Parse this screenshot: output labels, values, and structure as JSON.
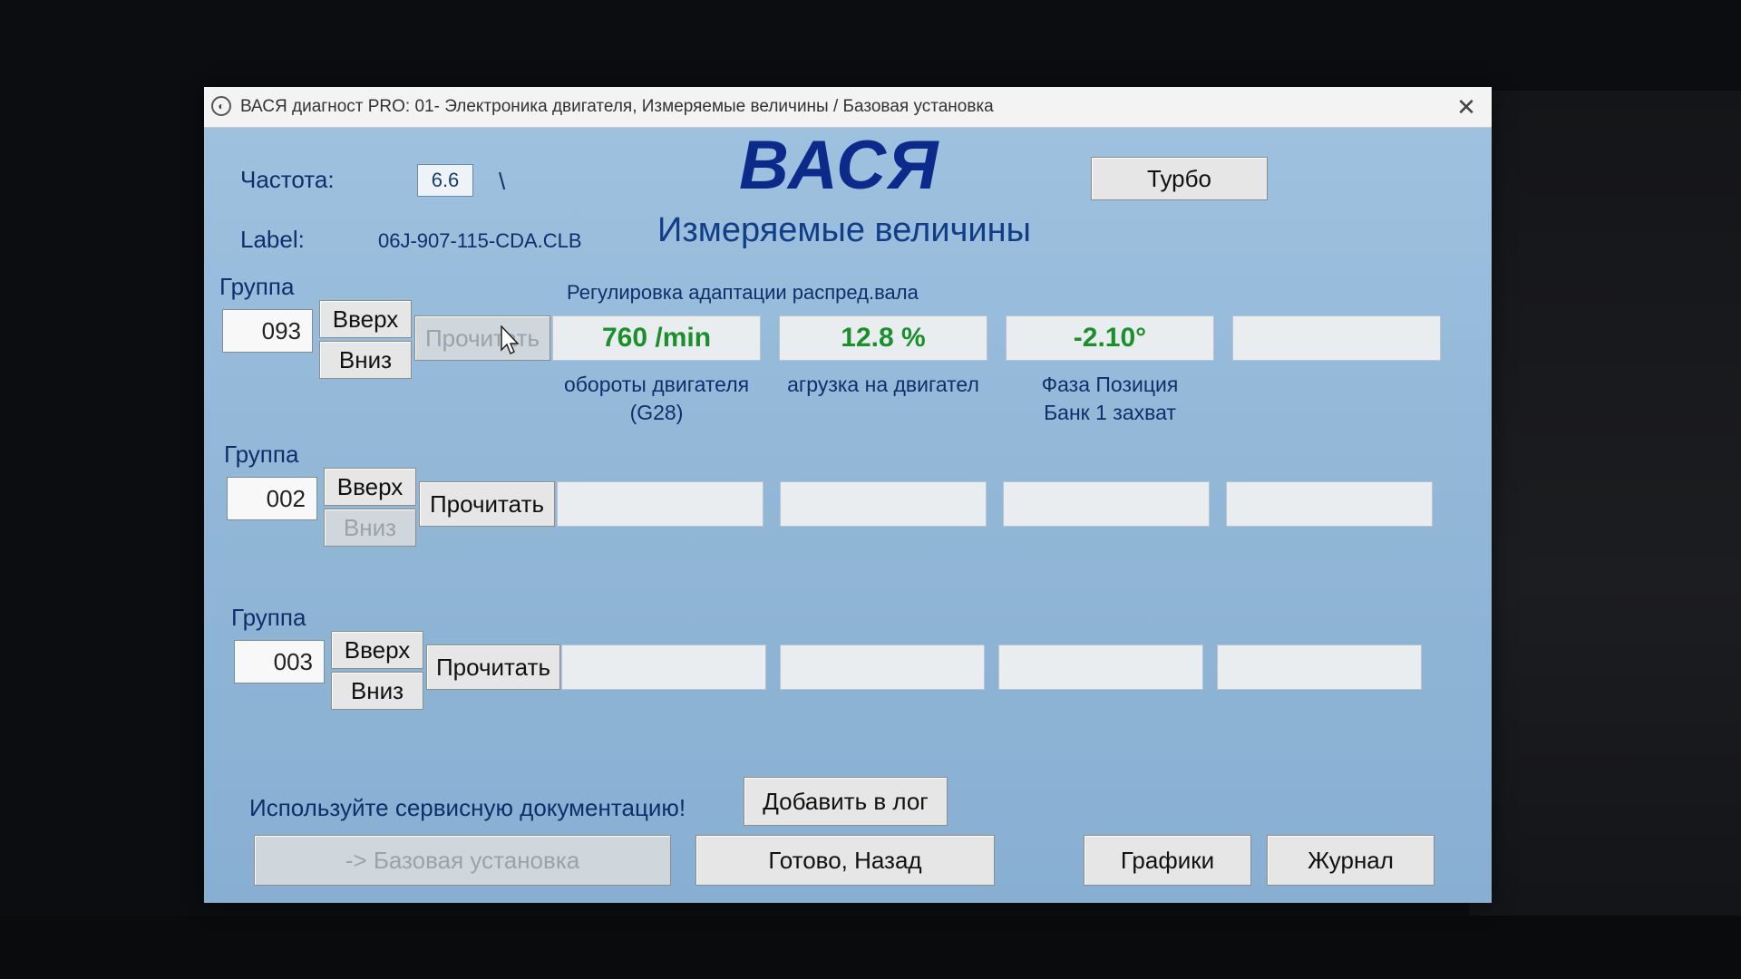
{
  "window": {
    "title": "ВАСЯ диагност PRO: 01- Электроника двигателя,  Измеряемые величины / Базовая установка",
    "close_glyph": "✕"
  },
  "header": {
    "freq_label": "Частота:",
    "freq_value": "6.6",
    "freq_indicator": "\\",
    "label_label": "Label:",
    "label_value": "06J-907-115-CDA.CLB",
    "brand": "ВАСЯ",
    "subtitle": "Измеряемые величины",
    "turbo_label": "Турбо"
  },
  "group_label": "Группа",
  "up_label": "Вверх",
  "down_label": "Вниз",
  "read_label": "Прочитать",
  "groups": [
    {
      "number": "093",
      "title": "Регулировка адаптации распред.вала",
      "cells": [
        "760 /min",
        "12.8 %",
        "-2.10°",
        ""
      ],
      "cell_labels": [
        [
          "обороты двигателя",
          "(G28)"
        ],
        [
          "агрузка на двигател",
          ""
        ],
        [
          "Фаза Позиция",
          "Банк 1 захват"
        ],
        [
          "",
          ""
        ]
      ],
      "read_enabled": false,
      "down_enabled": true
    },
    {
      "number": "002",
      "title": "",
      "cells": [
        "",
        "",
        "",
        ""
      ],
      "read_enabled": true,
      "down_enabled": false
    },
    {
      "number": "003",
      "title": "",
      "cells": [
        "",
        "",
        "",
        ""
      ],
      "read_enabled": true,
      "down_enabled": true
    }
  ],
  "footer": {
    "notice": "Используйте сервисную документацию!",
    "add_log_label": "Добавить в лог",
    "basic_setting_label": "-> Базовая установка",
    "done_back_label": "Готово, Назад",
    "graphs_label": "Графики",
    "journal_label": "Журнал"
  },
  "colors": {
    "window_bg": "#8fb4d3",
    "value_green": "#1b8f2c",
    "brand_blue": "#0b2a8a",
    "label_blue": "#0e2f6b"
  },
  "icons": [
    "app-icon",
    "close-icon",
    "mouse-cursor-icon"
  ]
}
